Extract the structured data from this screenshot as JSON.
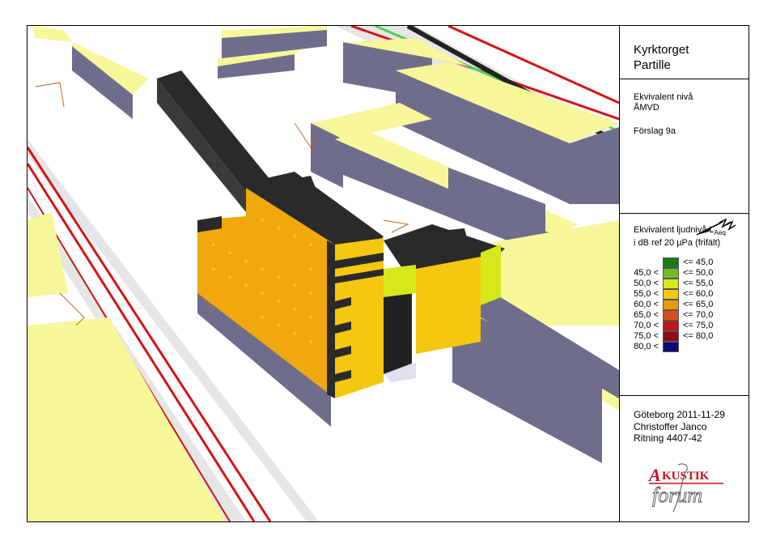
{
  "title": {
    "line1": "Kyrktorget",
    "line2": "Partille"
  },
  "level": {
    "line1": "Ekvivalent nivå",
    "line2": "ÅMVD"
  },
  "proposal": "Förslag 9a",
  "legend": {
    "line1_prefix": "Ekvivalent ljudnivå L",
    "line1_sub": "Aeq",
    "line2": "i dB ref 20 µPa (frifält)",
    "items": [
      {
        "left": "",
        "right": "<= 45,0",
        "color": "#1a7d14"
      },
      {
        "left": "45,0 <",
        "right": "<= 50,0",
        "color": "#73b829"
      },
      {
        "left": "50,0 <",
        "right": "<= 55,0",
        "color": "#d6e81b"
      },
      {
        "left": "55,0 <",
        "right": "<= 60,0",
        "color": "#f4c711"
      },
      {
        "left": "60,0 <",
        "right": "<= 65,0",
        "color": "#e69a0a"
      },
      {
        "left": "65,0 <",
        "right": "<= 70,0",
        "color": "#d7511c"
      },
      {
        "left": "70,0 <",
        "right": "<= 75,0",
        "color": "#c1161a"
      },
      {
        "left": "75,0 <",
        "right": "<= 80,0",
        "color": "#8a0d1b"
      },
      {
        "left": "80,0 <",
        "right": "",
        "color": "#0a0a7a"
      }
    ]
  },
  "footer": {
    "line1": "Göteborg 2011-11-29",
    "line2": "Christoffer Janco",
    "line3": "Ritning 4407-42"
  },
  "logo": {
    "word1": "KUSTIK",
    "word2": "forum",
    "initial": "A"
  },
  "icons": {
    "north": "north-arrow-icon"
  },
  "colors": {
    "roof": "#f8f79a",
    "wall": "#6e6e8c",
    "rail": "#d01515",
    "facade": "#f0a80c",
    "dark_roof": "#2a2a2a"
  }
}
